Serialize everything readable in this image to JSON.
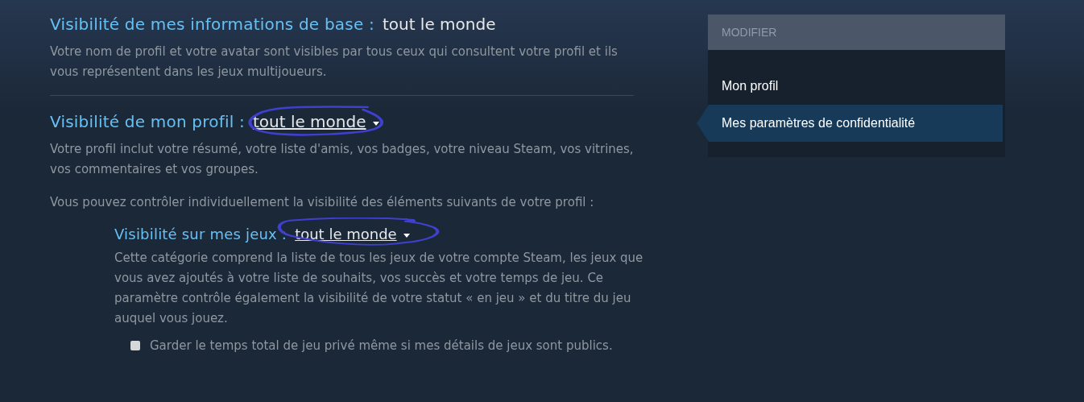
{
  "basic_info": {
    "label": "Visibilité de mes informations de base :",
    "value": "tout le monde",
    "description": "Votre nom de profil et votre avatar sont visibles par tous ceux qui consultent votre profil et ils vous représentent dans les jeux multijoueurs."
  },
  "profile": {
    "label": "Visibilité de mon profil :",
    "value": "tout le monde",
    "description": "Votre profil inclut votre résumé, votre liste d'amis, vos badges, votre niveau Steam, vos vitrines, vos commentaires et vos groupes.",
    "note": "Vous pouvez contrôler individuellement la visibilité des éléments suivants de votre profil :"
  },
  "games": {
    "label": "Visibilité sur mes jeux :",
    "value": "tout le monde",
    "description": "Cette catégorie comprend la liste de tous les jeux de votre compte Steam, les jeux que vous avez ajoutés à votre liste de souhaits, vos succès et votre temps de jeu. Ce paramètre contrôle également la visibilité de votre statut « en jeu » et du titre du jeu auquel vous jouez.",
    "option": {
      "label": "Garder le temps total de jeu privé même si mes détails de jeux sont publics.",
      "checked": false
    }
  },
  "sidebar": {
    "title": "MODIFIER",
    "items": [
      {
        "label": "Mon profil",
        "selected": false
      },
      {
        "label": "Mes paramètres de confidentialité",
        "selected": true
      }
    ]
  }
}
